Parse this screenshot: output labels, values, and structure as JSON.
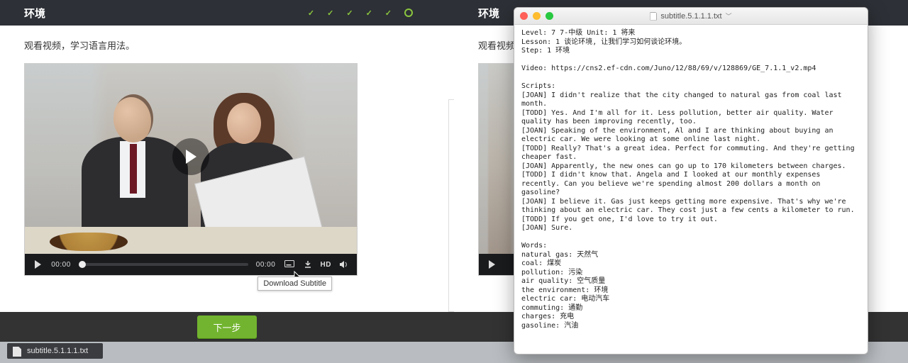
{
  "header": {
    "title": "环境",
    "step_count": 6,
    "current_step": 6
  },
  "instruction": "观看视频，学习语言用法。",
  "video": {
    "current_time": "00:00",
    "duration": "00:00",
    "quality_label": "HD",
    "download_tooltip": "Download Subtitle"
  },
  "actions": {
    "next_label": "下一步"
  },
  "download_chip": {
    "filename": "subtitle.5.1.1.1.txt"
  },
  "editor": {
    "window_title": "subtitle.5.1.1.1.txt",
    "text": "Level: 7 7-中级 Unit: 1 将来\nLesson: 1 谈论环境, 让我们学习如何谈论环境。\nStep: 1 环境\n\nVideo: https://cns2.ef-cdn.com/Juno/12/88/69/v/128869/GE_7.1.1_v2.mp4\n\nScripts:\n[JOAN] I didn't realize that the city changed to natural gas from coal last month.\n[TODD] Yes. And I'm all for it. Less pollution, better air quality. Water quality has been improving recently, too.\n[JOAN] Speaking of the environment, Al and I are thinking about buying an electric car. We were looking at some online last night.\n[TODD] Really? That's a great idea. Perfect for commuting. And they're getting cheaper fast.\n[JOAN] Apparently, the new ones can go up to 170 kilometers between charges.\n[TODD] I didn't know that. Angela and I looked at our monthly expenses recently. Can you believe we're spending almost 200 dollars a month on gasoline?\n[JOAN] I believe it. Gas just keeps getting more expensive. That's why we're thinking about an electric car. They cost just a few cents a kilometer to run.\n[TODD] If you get one, I'd love to try it out.\n[JOAN] Sure.\n\nWords:\nnatural gas: 天然气\ncoal: 煤炭\npollution: 污染\nair quality: 空气质量\nthe environment: 环境\nelectric car: 电动汽车\ncommuting: 通勤\ncharges: 充电\ngasoline: 汽油"
  }
}
